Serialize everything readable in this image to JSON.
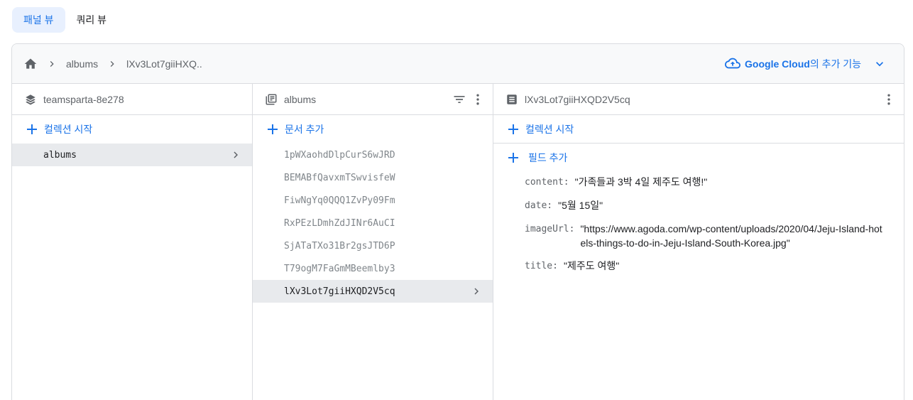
{
  "view_tabs": [
    {
      "label": "패널 뷰",
      "active": true
    },
    {
      "label": "쿼리 뷰",
      "active": false
    }
  ],
  "breadcrumb": {
    "items": [
      "albums",
      "lXv3Lot7giiHXQ.."
    ]
  },
  "google_cloud": {
    "brand": "Google Cloud",
    "suffix": "의 추가 기능"
  },
  "panels": {
    "root": {
      "title": "teamsparta-8e278",
      "add_label": "컬렉션 시작",
      "items": [
        {
          "label": "albums",
          "selected": true
        }
      ]
    },
    "collection": {
      "title": "albums",
      "add_label": "문서 추가",
      "items": [
        {
          "label": "1pWXaohdDlpCurS6wJRD",
          "selected": false
        },
        {
          "label": "BEMABfQavxmTSwvisfeW",
          "selected": false
        },
        {
          "label": "FiwNgYq0QQQ1ZvPy09Fm",
          "selected": false
        },
        {
          "label": "RxPEzLDmhZdJINr6AuCI",
          "selected": false
        },
        {
          "label": "SjATaTXo31Br2gsJTD6P",
          "selected": false
        },
        {
          "label": "T79ogM7FaGmMBeemlby3",
          "selected": false
        },
        {
          "label": "lXv3Lot7giiHXQD2V5cq",
          "selected": true
        }
      ]
    },
    "document": {
      "title": "lXv3Lot7giiHXQD2V5cq",
      "add_collection_label": "컬렉션 시작",
      "add_field_label": "필드 추가",
      "fields": [
        {
          "key": "content:",
          "value": "\"가족들과 3박 4일 제주도 여행!\""
        },
        {
          "key": "date:",
          "value": "\"5월 15일\""
        },
        {
          "key": "imageUrl:",
          "value": "\"https://www.agoda.com/wp-content/uploads/2020/04/Jeju-Island-hotels-things-to-do-in-Jeju-Island-South-Korea.jpg\""
        },
        {
          "key": "title:",
          "value": "\"제주도 여행\""
        }
      ]
    }
  },
  "colors": {
    "accent": "#1a73e8",
    "selected_bg": "#e8eaed",
    "tab_active_bg": "#e8f0fe",
    "border": "#dadce0"
  }
}
